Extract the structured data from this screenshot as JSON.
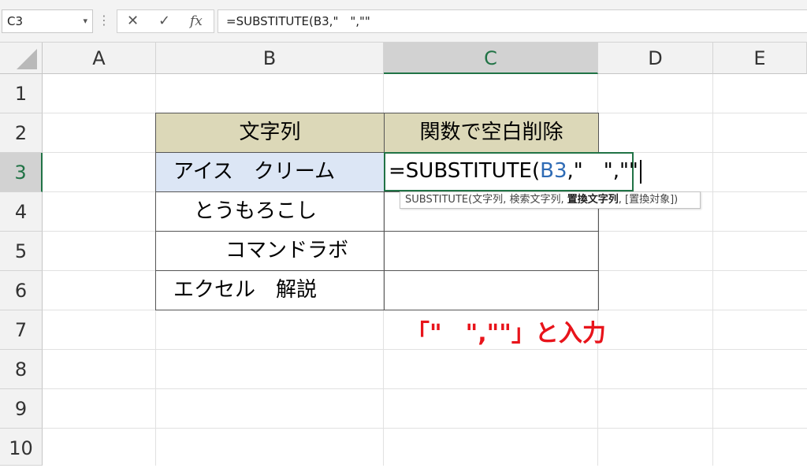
{
  "formula_bar": {
    "name_box": "C3",
    "name_box_dropdown": "▾",
    "separator": "⋮",
    "cancel_glyph": "✕",
    "enter_glyph": "✓",
    "insert_function": "fx",
    "formula": "=SUBSTITUTE(B3,\"　\",\"\""
  },
  "columns": [
    "A",
    "B",
    "C",
    "D",
    "E"
  ],
  "rows": [
    "1",
    "2",
    "3",
    "4",
    "5",
    "6",
    "7",
    "8",
    "9",
    "10"
  ],
  "active_cell": {
    "column": "C",
    "row": "3"
  },
  "table": {
    "headers": [
      "文字列",
      "関数で空白削除"
    ],
    "b_values": [
      "アイス　クリーム",
      "　とうもろこし",
      "　　　コマンドラボ",
      "エクセル　解説"
    ]
  },
  "edit_cell": {
    "prefix": "=SUBSTITUTE(",
    "ref": "B3",
    "suffix": ",\"　\",\"\""
  },
  "tooltip": {
    "function": "SUBSTITUTE(",
    "arg1": "文字列",
    "sep1": ", ",
    "arg2": "検索文字列",
    "sep2": ", ",
    "arg3_bold": "置換文字列",
    "sep3": ", ",
    "arg4": "[置換対象]",
    "close": ")"
  },
  "annotation": {
    "text": "「\"　\",\"\"」と入力",
    "color": "#e8141b"
  },
  "colors": {
    "header_fill": "#dcd8b8",
    "selected_fill": "#dce6f5",
    "active_green": "#217346",
    "reference_blue": "#2e6bb5"
  }
}
